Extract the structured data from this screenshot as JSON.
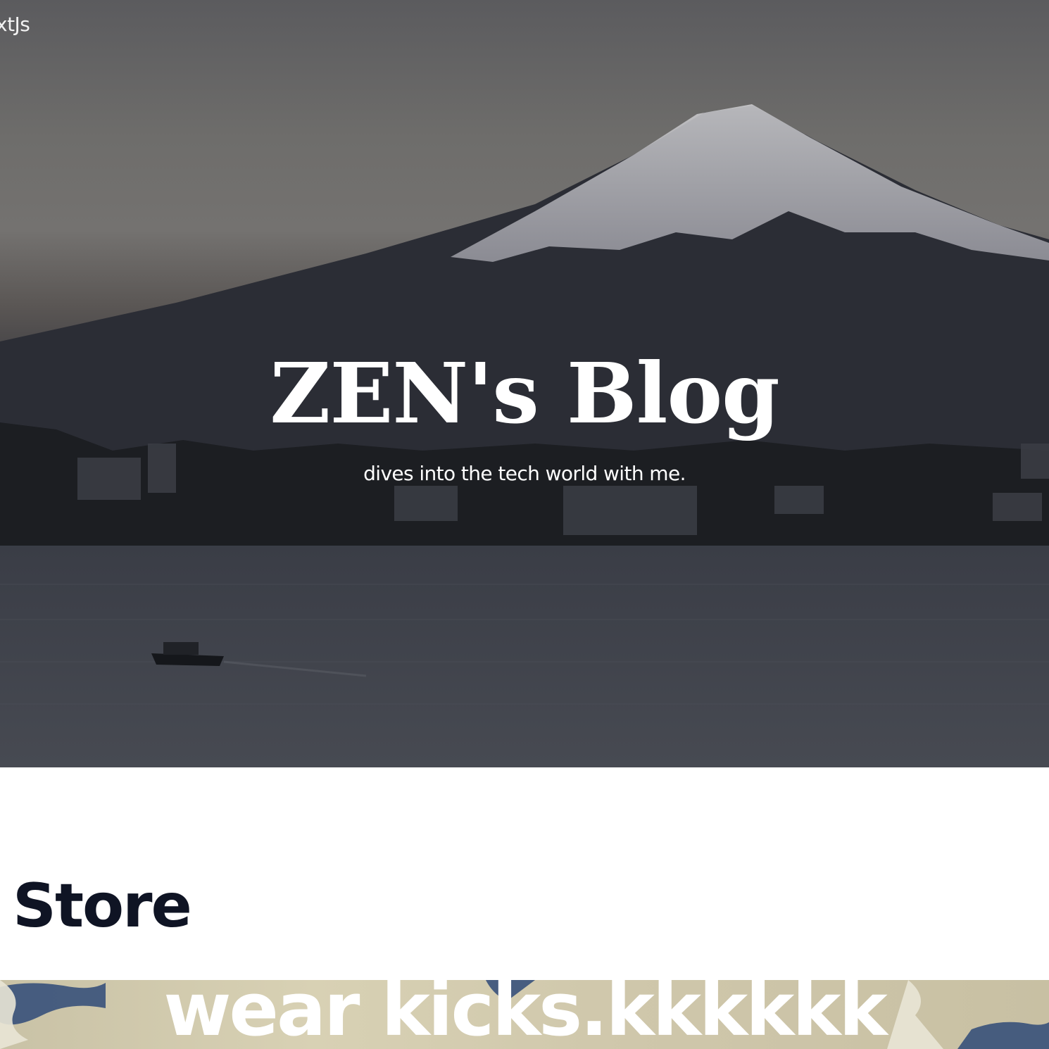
{
  "nav": {
    "brand": "xtJs"
  },
  "hero": {
    "title": "ZEN's Blog",
    "subtitle": "dives into the tech world with me."
  },
  "store": {
    "heading": "Store",
    "banner_text": "wear kicks.kkkkkk"
  },
  "colors": {
    "heading_dark": "#0f1424",
    "hero_text": "#ffffff",
    "page_background": "#ffffff"
  }
}
